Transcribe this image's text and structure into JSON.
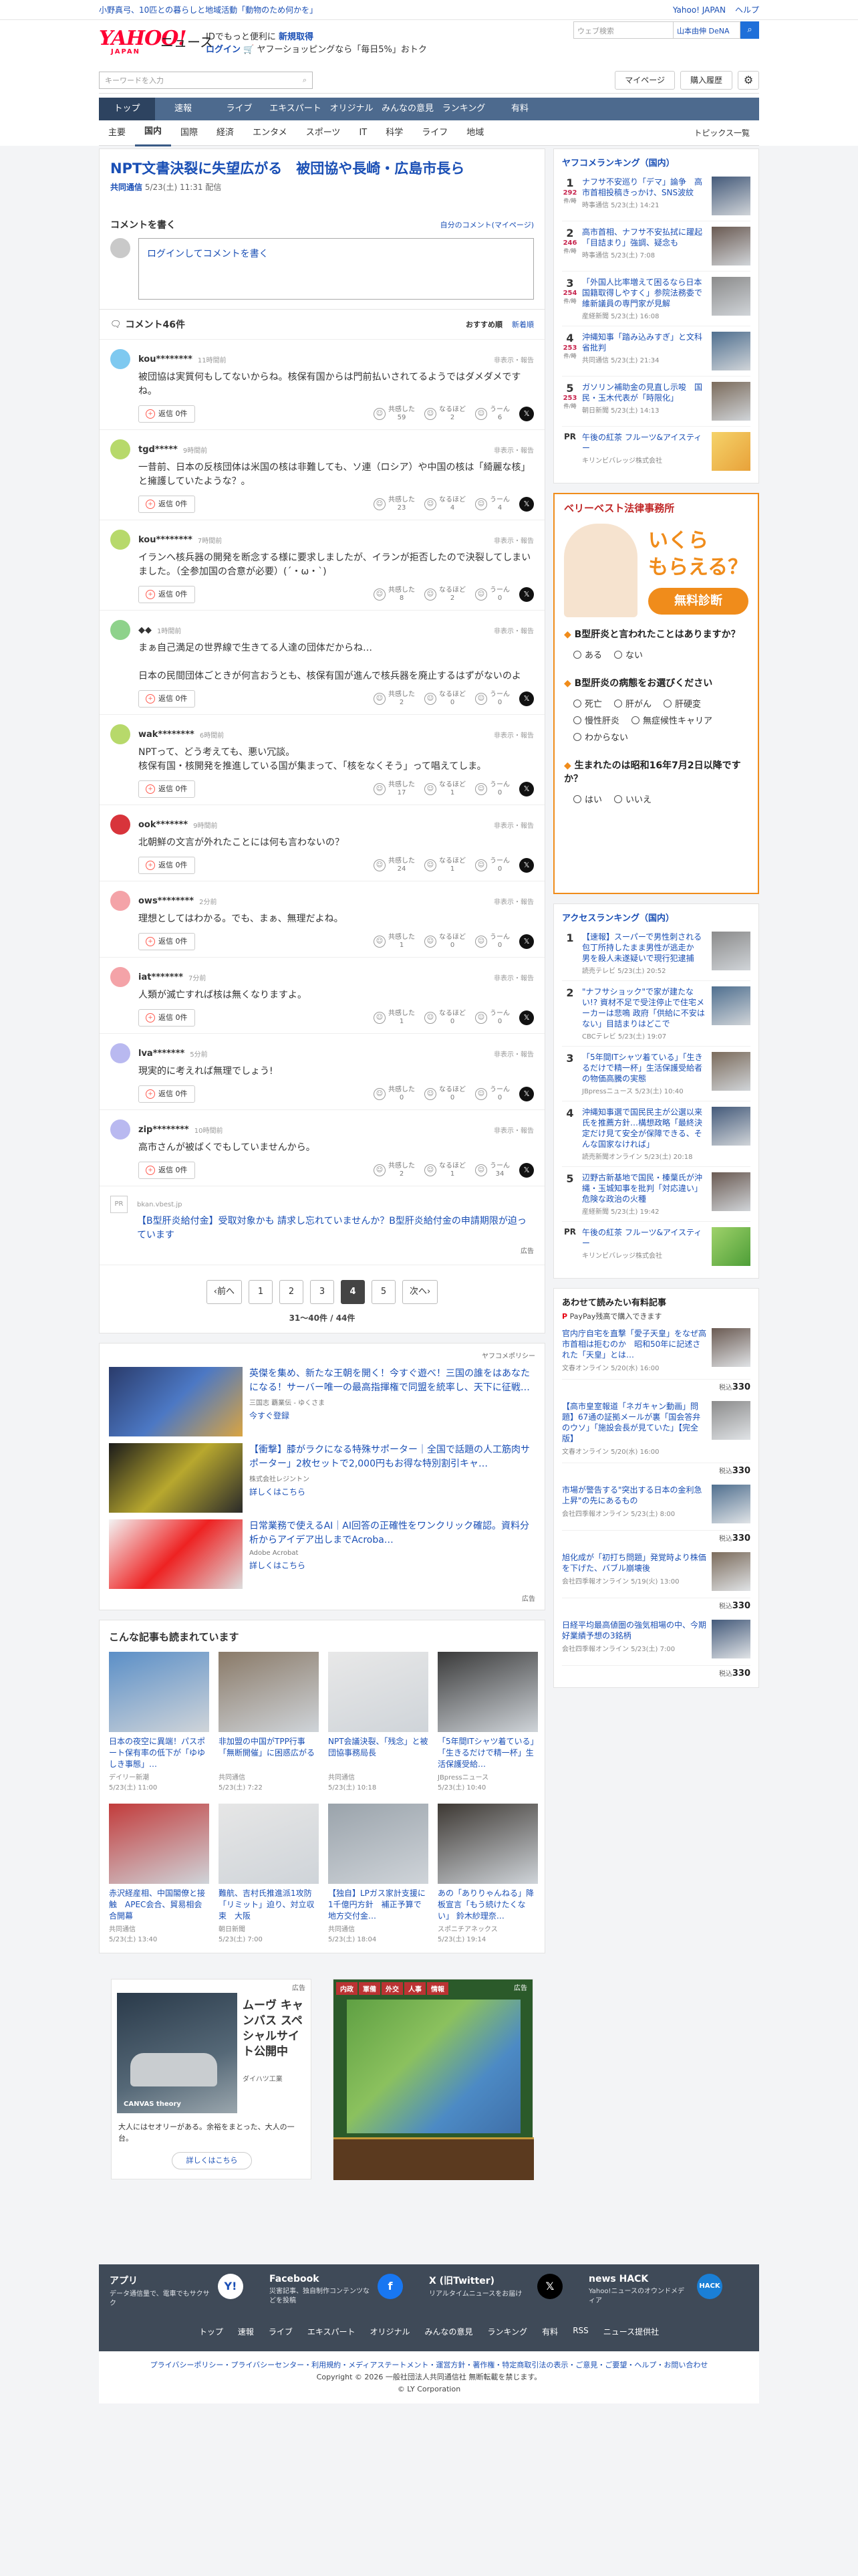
{
  "topbar": {
    "promo": "小野真弓、10匹との暮らしと地域活動「動物のため何かを」",
    "links": [
      "Yahoo! JAPAN",
      "ヘルプ"
    ]
  },
  "brand": {
    "logo": "YAHOO!",
    "logo_sub": "JAPAN",
    "service": "ニュース",
    "promo1": "IDでもっと便利に",
    "promo1b": "新規取得",
    "promo2a": "ログイン",
    "promo2b": "ヤフーショッピングなら「毎日5%」おトク",
    "search_placeholder": "ウェブ検索",
    "search_suggest": "山本由伸 DeNA"
  },
  "toolbar": {
    "keyword_placeholder": "キーワードを入力",
    "mypage": "マイページ",
    "history": "購入履歴"
  },
  "nav": {
    "items": [
      "トップ",
      "速報",
      "ライブ",
      "エキスパート",
      "オリジナル",
      "みんなの意見",
      "ランキング",
      "有料"
    ]
  },
  "subnav": {
    "items": [
      "主要",
      "国内",
      "国際",
      "経済",
      "エンタメ",
      "スポーツ",
      "IT",
      "科学",
      "ライフ",
      "地域"
    ],
    "right": "トピックス一覧"
  },
  "article": {
    "title": "NPT文書決裂に失望広がる　被団協や長崎・広島市長ら",
    "source": "共同通信",
    "date": "5/23(土) 11:31 配信"
  },
  "comment_form": {
    "title": "コメントを書く",
    "my_comments": "自分のコメント(マイページ)",
    "placeholder": "ログインしてコメントを書く"
  },
  "comments_header": {
    "title": "コメント46件",
    "sort1": "おすすめ順",
    "sort2": "新着順"
  },
  "comment_ui": {
    "reply": "返信 0件",
    "report": "非表示・報告",
    "r1": "共感した",
    "r2": "なるほど",
    "r3": "うーん"
  },
  "comments": [
    {
      "user": "kou********",
      "time": "11時間前",
      "text": "被団協は実質何もしてないからね。核保有国からは門前払いされてるようではダメダメですね。",
      "c1": "59",
      "c2": "2",
      "c3": "6",
      "color": "#7ec9f0"
    },
    {
      "user": "tgd*****",
      "time": "9時間前",
      "text": "一昔前、日本の反核団体は米国の核は非難しても、ソ連（ロシア）や中国の核は「綺麗な核」と擁護していたような？。",
      "c1": "23",
      "c2": "4",
      "c3": "4",
      "color": "#b7d96b"
    },
    {
      "user": "kou********",
      "time": "7時間前",
      "text": "イランへ核兵器の開発を断念する様に要求しましたが、イランが拒否したので決裂してしまいました。（全参加国の合意が必要）(´・ω・`)",
      "c1": "8",
      "c2": "2",
      "c3": "0",
      "color": "#b7d96b"
    },
    {
      "user": "◆◆",
      "time": "1時間前",
      "text": "まぁ自己満足の世界線で生きてる人達の団体だからね…\n\n日本の民間団体ごときが何言おうとも、核保有国が進んで核兵器を廃止するはずがないのよ",
      "c1": "2",
      "c2": "0",
      "c3": "0",
      "color": "#8ed28b"
    },
    {
      "user": "wak********",
      "time": "6時間前",
      "text": "NPTって、どう考えても、悪い冗談。\n核保有国・核開発を推進している国が集まって、「核をなくそう」って唱えてしま。",
      "c1": "17",
      "c2": "1",
      "c3": "0",
      "color": "#b7d96b"
    },
    {
      "user": "ook*******",
      "time": "9時間前",
      "text": "北朝鮮の文言が外れたことには何も言わないの？",
      "c1": "24",
      "c2": "1",
      "c3": "0",
      "color": "#d8343b"
    },
    {
      "user": "ows********",
      "time": "2分前",
      "text": "理想としてはわかる。でも、まぁ、無理だよね。",
      "c1": "1",
      "c2": "0",
      "c3": "0",
      "color": "#f4a3a8"
    },
    {
      "user": "iat*******",
      "time": "7分前",
      "text": "人類が滅亡すれば核は無くなりますよ。",
      "c1": "1",
      "c2": "0",
      "c3": "0",
      "color": "#f4a3a8"
    },
    {
      "user": "lva*******",
      "time": "5分前",
      "text": "現実的に考えれば無理でしょう!",
      "c1": "0",
      "c2": "0",
      "c3": "0",
      "color": "#b9b9f0"
    },
    {
      "user": "zip********",
      "time": "10時間前",
      "text": "高市さんが被ばくでもしていませんから。",
      "c1": "2",
      "c2": "1",
      "c3": "34",
      "color": "#b9b9f0"
    }
  ],
  "pr": {
    "label": "PR",
    "site": "bkan.vbest.jp",
    "text": "【B型肝炎給付金】受取対象かも 請求し忘れていませんか？B型肝炎給付金の申請期限が迫っています",
    "ad": "広告"
  },
  "pagination": {
    "prev": "‹前へ",
    "pages": [
      "1",
      "2",
      "3",
      "4",
      "5"
    ],
    "current": "4",
    "next": "次へ›",
    "count": "31〜40件 / 44件"
  },
  "ads": {
    "policy": "ヤフコメポリシー",
    "items": [
      {
        "title": "英傑を集め、新たな王朝を開く！今すぐ遊べ！三国の誰をはあなたになる！サーバー唯一の最高指揮権で同盟を統率し、天下に征戦…",
        "sponsor": "三国志 覇業伝 - ゆくさま",
        "cta": "今すぐ登録"
      },
      {
        "title": "【衝撃】膝がラクになる特殊サポーター｜全国で話題の人工筋肉サポーター」2枚セットで2,000円もお得な特別割引キャ…",
        "sponsor": "株式会社レジントン",
        "cta": "詳しくはこちら"
      },
      {
        "title": "日常業務で使えるAI｜AI回答の正確性をワンクリック確認。資料分析からアイデア出しまでAcroba…",
        "sponsor": "Adobe Acrobat",
        "cta": "詳しくはこちら"
      }
    ],
    "ad_mark": "広告"
  },
  "more": {
    "title": "こんな記事も読まれています",
    "items": [
      {
        "t": "日本の夜空に異端！パスポート保有率の低下が「ゆゆしき事態」…",
        "s": "デイリー新潮",
        "d": "5/23(土) 11:00"
      },
      {
        "t": "非加盟の中国がTPP行事「無断開催」に困惑広がる",
        "s": "共同通信",
        "d": "5/23(土) 7:22"
      },
      {
        "t": "NPT会議決裂、「残念」と被団協事務局長",
        "s": "共同通信",
        "d": "5/23(土) 10:18"
      },
      {
        "t": "「5年間ITシャツ着ている」「生きるだけで精一杯」生活保護受給…",
        "s": "JBpressニュース",
        "d": "5/23(土) 10:40"
      },
      {
        "t": "赤沢経産相、中国閣僚と接触　APEC会合、貿易相会合開幕",
        "s": "共同通信",
        "d": "5/23(土) 13:40"
      },
      {
        "t": "難航、吉村氏推進派1攻防「リミット」迫り、対立収束　大阪",
        "s": "朝日新聞",
        "d": "5/23(土) 7:00"
      },
      {
        "t": "【独自】LPガス家計支援に1千億円方針　補正予算で地方交付金…",
        "s": "共同通信",
        "d": "5/23(土) 18:04"
      },
      {
        "t": "あの「ありりゃんねる」降板宣言「もう続けたくない」 鈴木紗理奈…",
        "s": "スポニチアネックス",
        "d": "5/23(土) 19:14"
      }
    ]
  },
  "bottom_ads": {
    "car_title": "ムーヴ キャンバス スペシャルサイト公開中",
    "car_sponsor": "ダイハツ工業",
    "car_desc": "大人にはセオリーがある。余裕をまとった、大人の一台。",
    "car_cta": "詳しくはこちら",
    "car_brand": "CANVAS theory",
    "game_tabs": [
      "内政",
      "軍備",
      "外交",
      "人事",
      "情報"
    ],
    "ad": "広告"
  },
  "footer": {
    "apps": [
      {
        "t": "アプリ",
        "d": "データ通信量で、電車でもサクサク"
      },
      {
        "t": "Facebook",
        "d": "災害記事、独自制作コンテンツなどを投稿"
      },
      {
        "t": "X (旧Twitter)",
        "d": "リアルタイムニュースをお届け"
      },
      {
        "t": "news HACK",
        "d": "Yahoo!ニュースのオウンドメディア"
      }
    ],
    "links": [
      "トップ",
      "速報",
      "ライブ",
      "エキスパート",
      "オリジナル",
      "みんなの意見",
      "ランキング",
      "有料",
      "RSS",
      "ニュース提供社"
    ],
    "legal": "プライバシーポリシー・プライバシーセンター・利用規約・メディアステートメント・運営方針・著作権・特定商取引法の表示・ご意見・ご要望・ヘルプ・お問い合わせ",
    "copyright": "Copyright © 2026 一般社団法人共同通信社 無断転載を禁じます。",
    "corp": "© LY Corporation"
  },
  "ranking": {
    "title": "ヤフコメランキング（国内）",
    "items": [
      {
        "n": "1",
        "c": "292",
        "t": "ナフサ不安巡り「デマ」論争　高市首相投稿きっかけ、SNS波紋",
        "s": "時事通信 5/23(土) 14:21"
      },
      {
        "n": "2",
        "c": "246",
        "t": "高市首相、ナフサ不安払拭に躍起「目詰まり」強調、疑念も",
        "s": "時事通信 5/23(土) 7:08"
      },
      {
        "n": "3",
        "c": "254",
        "t": "「外国人比率増えて困るなら日本国籍取得しやすく」参院法務委で維新議員の専門家が見解",
        "s": "産経新聞 5/23(土) 16:08"
      },
      {
        "n": "4",
        "c": "253",
        "t": "沖縄知事「踏み込みすぎ」と文科省批判",
        "s": "共同通信 5/23(土) 21:34"
      },
      {
        "n": "5",
        "c": "253",
        "t": "ガソリン補助金の見直し示唆　国民・玉木代表が「時限化」",
        "s": "朝日新聞 5/23(土) 14:13"
      }
    ],
    "pr_title": "午後の紅茶 フルーツ&アイスティー",
    "pr_sponsor": "キリンビバレッジ株式会社",
    "unit": "件/時"
  },
  "side_ad": {
    "brand": "ベリーベスト法律事務所",
    "headline1": "いくら",
    "headline2": "もらえる？",
    "cta": "無料診断",
    "q1": "B型肝炎と言われたことはありますか？",
    "q1o": [
      "ある",
      "ない"
    ],
    "q2": "B型肝炎の病態をお選びください",
    "q2o": [
      "死亡",
      "肝がん",
      "肝硬変",
      "慢性肝炎",
      "無症候性キャリア",
      "わからない"
    ],
    "q3": "生まれたのは昭和16年7月2日以降ですか？",
    "q3o": [
      "はい",
      "いいえ"
    ]
  },
  "access": {
    "title": "アクセスランキング（国内）",
    "items": [
      {
        "n": "1",
        "t": "【速報】スーパーで男性刺される　包丁所持したまま男性が逃走か　男を殺人未遂疑いで現行犯逮捕",
        "s": "読売テレビ 5/23(土) 20:52"
      },
      {
        "n": "2",
        "t": "\"ナフサショック\"で家が建たない!? 資材不足で受注停止で住宅メーカーは悲鳴 政府「供給に不安はない」目詰まりはどこで",
        "s": "CBCテレビ 5/23(土) 19:07"
      },
      {
        "n": "3",
        "t": "「5年間ITシャツ着ている」「生きるだけで精一杯」生活保護受給者の物価高騰の実態",
        "s": "JBpressニュース 5/23(土) 10:40"
      },
      {
        "n": "4",
        "t": "沖縄知事選で国民民主が公選以来氏を推薦方針…構想政略「最終決定だけ見て安全が保障できる、そんな国家なければ」",
        "s": "読売新聞オンライン 5/23(土) 20:18"
      },
      {
        "n": "5",
        "t": "辺野古新基地で国民・榛葉氏が沖縄・玉城知事を批判「対応違い」　危険な政治の火種",
        "s": "産経新聞 5/23(土) 19:42"
      }
    ],
    "pr_title": "午後の紅茶 フルーツ&アイスティー",
    "pr_sponsor": "キリンビバレッジ株式会社"
  },
  "paid": {
    "title": "あわせて読みたい有料記事",
    "sub": "PayPay残高で購入できます",
    "items": [
      {
        "t": "官内庁自宅を直撃「愛子天皇」をなぜ高市首相は拒むのか　昭和50年に記述された「天皇」とは…",
        "s": "文春オンライン 5/20(水) 16:00",
        "p": "330"
      },
      {
        "t": "【高市皇室報道「ネガキャン動画」問題】67通の証拠メールが裏「国会答弁のウソ」「施設会長が見ていた」【完全版】",
        "s": "文春オンライン 5/20(水) 16:00",
        "p": "330"
      },
      {
        "t": "市場が警告する\"突出する日本の金利急上昇\"の先にあるもの",
        "s": "会社四季報オンライン 5/23(土) 8:00",
        "p": "330"
      },
      {
        "t": "旭化成が「初打ち問題」発覚時より株価を下げた、バブル崩壊後",
        "s": "会社四季報オンライン 5/19(火) 13:00",
        "p": "330"
      },
      {
        "t": "日経平均最高値圏の強気相場の中、今期好業績予想の3銘柄",
        "s": "会社四季報オンライン 5/23(土) 7:00",
        "p": "330"
      }
    ],
    "yen": "税込"
  }
}
